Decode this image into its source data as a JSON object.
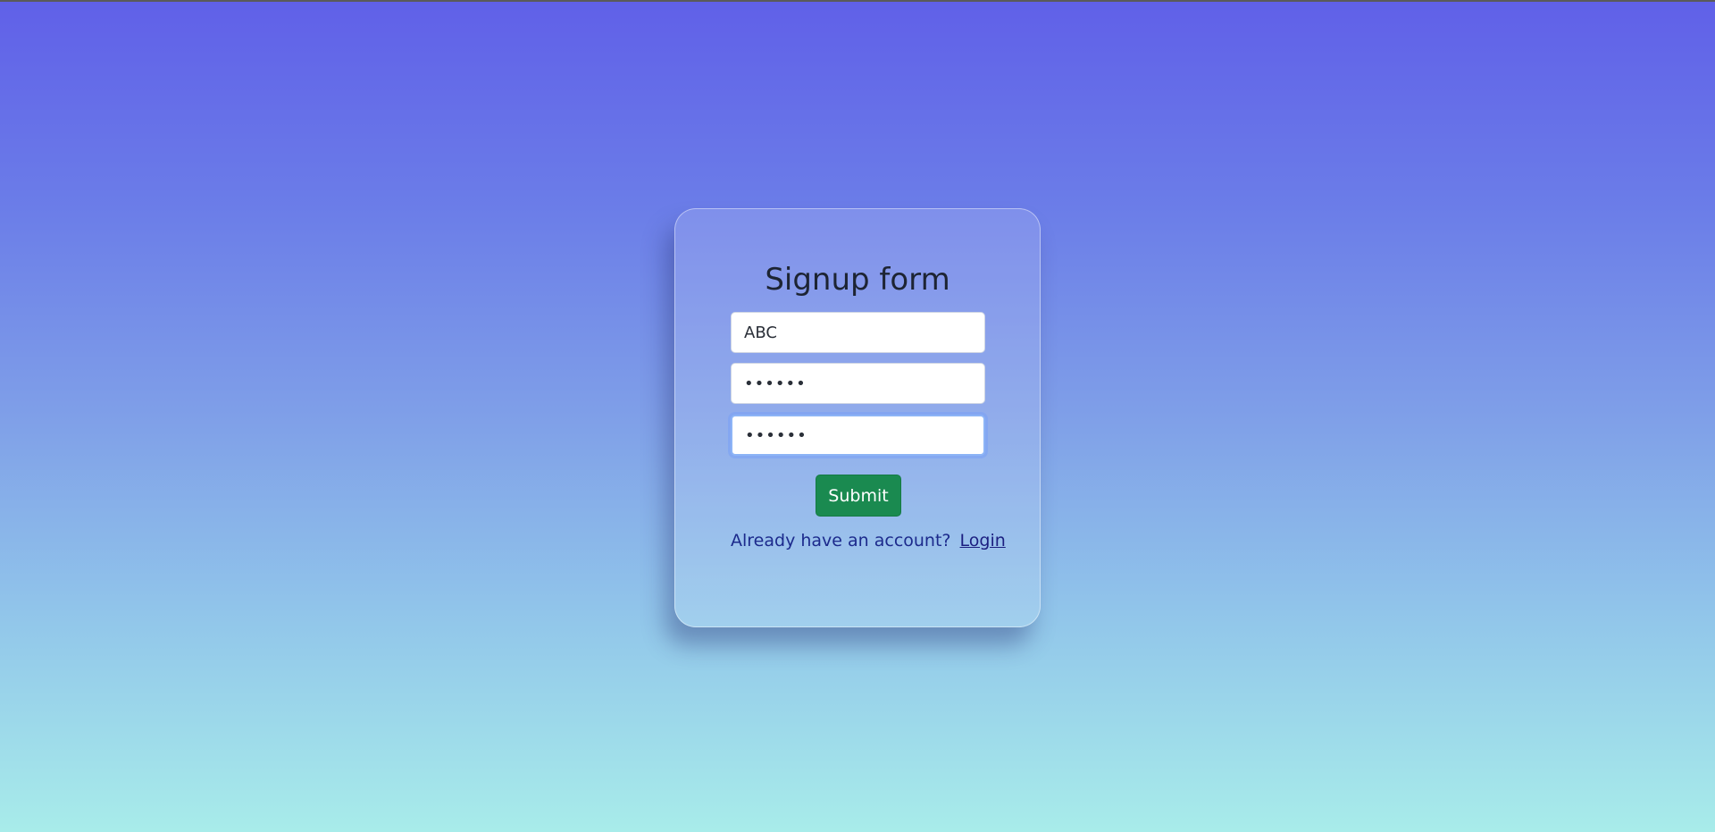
{
  "signup": {
    "title": "Signup form",
    "username_value": "ABC",
    "password_value": "••••••",
    "confirm_password_value": "••••••",
    "submit_label": "Submit",
    "footer_text": "Already have an account?",
    "login_link_label": "Login"
  },
  "colors": {
    "submit_button": "#1a8a50",
    "link": "#1c1f80"
  }
}
